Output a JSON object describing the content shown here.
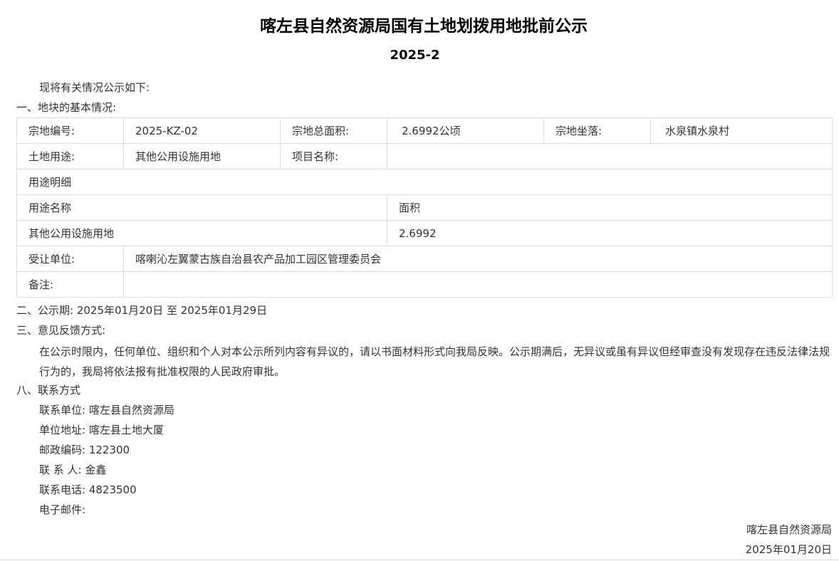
{
  "document": {
    "title": "喀左县自然资源局国有土地划拨用地批前公示",
    "number": "2025-2",
    "intro": "现将有关情况公示如下:",
    "section1_heading": "一、地块的基本情况:",
    "table": {
      "row1": {
        "parcel_no_label": "宗地编号:",
        "parcel_no_value": "2025-KZ-02",
        "area_label": "宗地总面积:",
        "area_value": "2.6992公顷",
        "location_label": "宗地坐落:",
        "location_value": "水泉镇水泉村"
      },
      "row2": {
        "use_label": "土地用途:",
        "use_value": "其他公用设施用地",
        "project_label": "项目名称:",
        "project_value": ""
      },
      "row3": {
        "detail_label": "用途明细"
      },
      "row4": {
        "use_name_header": "用途名称",
        "area_header": "面积"
      },
      "row5": {
        "use_name_value": "其他公用设施用地",
        "area_value": "2.6992"
      },
      "row6": {
        "grantee_label": "受让单位:",
        "grantee_value": "喀喇沁左翼蒙古族自治县农产品加工园区管理委员会"
      },
      "row7": {
        "remarks_label": "备注:",
        "remarks_value": ""
      }
    },
    "section2": "二、公示期: 2025年01月20日 至 2025年01月29日",
    "section3_heading": "三、意见反馈方式:",
    "section3_body": "在公示时限内，任何单位、组织和个人对本公示所列内容有异议的，请以书面材料形式向我局反映。公示期满后，无异议或虽有异议但经审查没有发现存在违反法律法规行为的，我局将依法报有批准权限的人民政府审批。",
    "section8_heading": "八、联系方式",
    "contact": {
      "unit": "联系单位: 喀左县自然资源局",
      "address": "单位地址: 喀左县土地大厦",
      "postcode": "邮政编码: 122300",
      "person": "联 系 人: 金鑫",
      "phone": "联系电话: 4823500",
      "email": "电子邮件:"
    },
    "signature": {
      "org": "喀左县自然资源局",
      "date": "2025年01月20日"
    }
  }
}
